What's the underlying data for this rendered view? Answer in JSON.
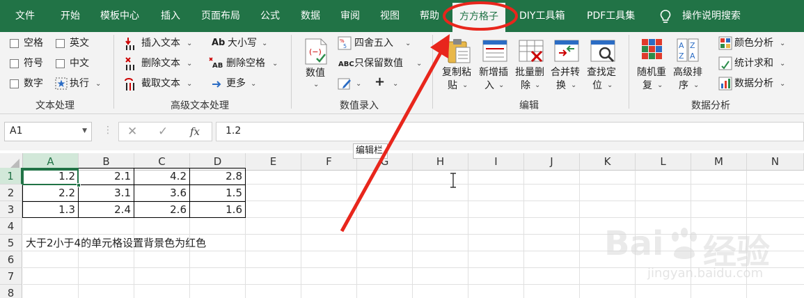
{
  "tabs": [
    {
      "label": "文件"
    },
    {
      "label": "开始"
    },
    {
      "label": "模板中心"
    },
    {
      "label": "插入"
    },
    {
      "label": "页面布局"
    },
    {
      "label": "公式"
    },
    {
      "label": "数据"
    },
    {
      "label": "审阅"
    },
    {
      "label": "视图"
    },
    {
      "label": "帮助"
    },
    {
      "label": "方方格子",
      "active": true
    },
    {
      "label": "DIY工具箱"
    },
    {
      "label": "PDF工具集"
    }
  ],
  "tellme": "操作说明搜索",
  "ribbon": {
    "text_processing": {
      "checkboxes": [
        "空格",
        "英文",
        "符号",
        "中文",
        "数字"
      ],
      "execute": "执行",
      "group": "文本处理"
    },
    "advanced_text": {
      "insert_text": "插入文本",
      "delete_text": "删除文本",
      "extract_text": "截取文本",
      "case": "大小写",
      "case_icon_text": "Ab",
      "delete_spaces": "删除空格",
      "more": "更多",
      "group": "高级文本处理"
    },
    "numeric": {
      "value_label": "数值",
      "round": "四舍五入",
      "keep_value": "只保留数值",
      "keep_icon_text": "ABC",
      "plus": "+",
      "group": "数值录入"
    },
    "edit": {
      "copy_paste": [
        "复制粘",
        "贴"
      ],
      "add_insert": [
        "新增插",
        "入"
      ],
      "batch_delete": [
        "批量删",
        "除"
      ],
      "merge_convert": [
        "合并转",
        "换"
      ],
      "find_locate": [
        "查找定",
        "位"
      ],
      "group": "编辑"
    },
    "analysis": {
      "random_shuffle": [
        "随机重",
        "复"
      ],
      "advanced_sort": [
        "高级排",
        "序"
      ],
      "color_analysis": "颜色分析",
      "stat_sum": "统计求和",
      "data_analysis": "数据分析",
      "group": "数据分析"
    }
  },
  "formula_bar": {
    "name_box": "A1",
    "fx": "fx",
    "value": "1.2"
  },
  "tooltip": "编辑栏",
  "columns": [
    "A",
    "B",
    "C",
    "D",
    "E",
    "F",
    "G",
    "H",
    "I",
    "J",
    "K",
    "L",
    "M",
    "N"
  ],
  "rows": [
    "1",
    "2",
    "3",
    "4",
    "5",
    "6",
    "7",
    "8"
  ],
  "cells": {
    "r1": [
      "1.2",
      "2.1",
      "4.2",
      "2.8"
    ],
    "r2": [
      "2.2",
      "3.1",
      "3.6",
      "1.5"
    ],
    "r3": [
      "1.3",
      "2.4",
      "2.6",
      "1.6"
    ],
    "a5": "大于2小于4的单元格设置背景色为红色"
  },
  "watermark": {
    "brand": "Bai",
    "brand_suffix": "经验",
    "url": "jingyan.baidu.com"
  },
  "colors": {
    "ribbon_green": "#217346",
    "annotation_red": "#e8261c"
  }
}
